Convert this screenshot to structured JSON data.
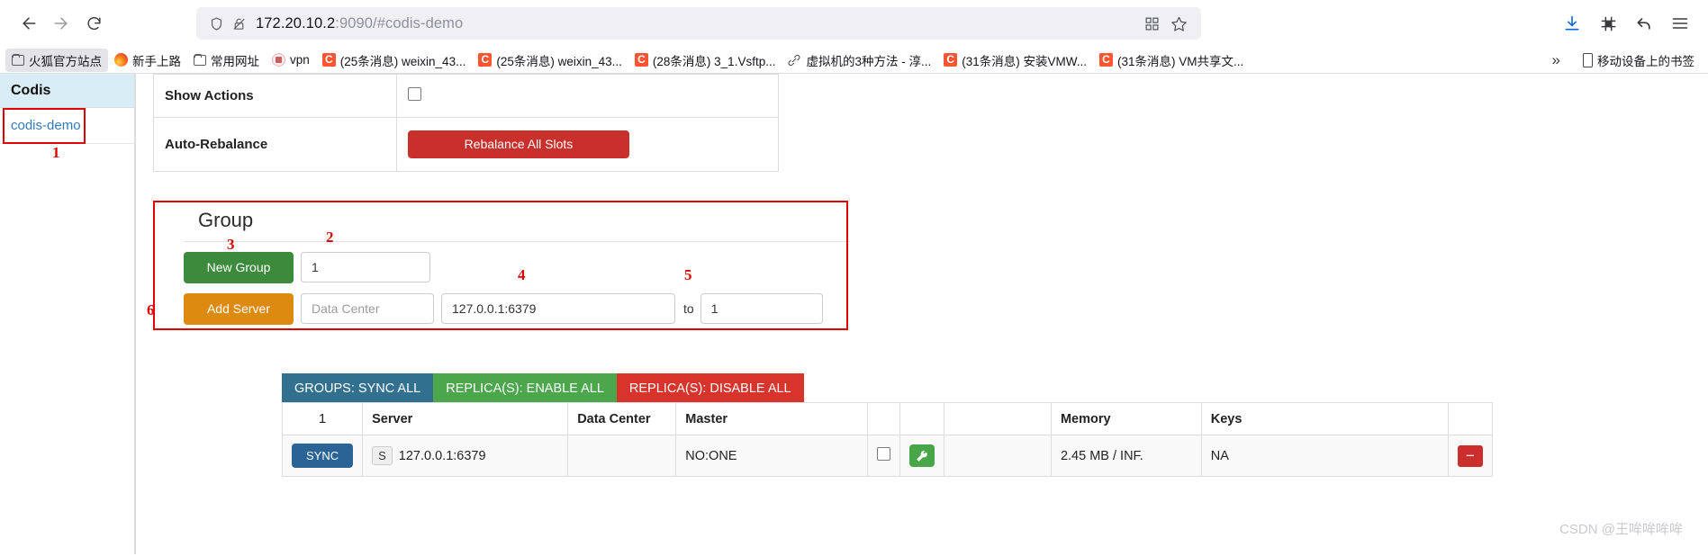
{
  "browser": {
    "nav": {
      "back_icon": "arrow-left-icon",
      "forward_icon": "arrow-right-icon",
      "reload_icon": "reload-icon"
    },
    "url_bar": {
      "shield_icon": "shield-icon",
      "lock_broken_icon": "lock-slash-icon",
      "url_host": "172.20.10.2",
      "url_rest": ":9090/#codis-demo",
      "qr_icon": "qr-code-icon",
      "bookmark_icon": "star-icon"
    },
    "toolbar_right": {
      "download_icon": "download-icon",
      "clip_icon": "clipboard-icon",
      "sync_icon": "undo-arrow-icon",
      "menu_icon": "hamburger-menu-icon"
    },
    "bookmarks": [
      {
        "label": "火狐官方站点",
        "icon": "folder-icon",
        "active": true
      },
      {
        "label": "新手上路",
        "icon": "firefox-icon",
        "active": false
      },
      {
        "label": "常用网址",
        "icon": "folder-icon",
        "active": false
      },
      {
        "label": "vpn",
        "icon": "vpn-site-icon",
        "active": false
      },
      {
        "label": "(25条消息) weixin_43...",
        "icon": "csdn-icon",
        "active": false
      },
      {
        "label": "(25条消息) weixin_43...",
        "icon": "csdn-icon",
        "active": false
      },
      {
        "label": "(28条消息) 3_1.Vsftp...",
        "icon": "csdn-icon",
        "active": false
      },
      {
        "label": "虚拟机的3种方法 - 淳...",
        "icon": "link-icon",
        "active": false
      },
      {
        "label": "(31条消息) 安装VMW...",
        "icon": "csdn-icon",
        "active": false
      },
      {
        "label": "(31条消息) VM共享文...",
        "icon": "csdn-icon",
        "active": false
      }
    ],
    "bookmarks_overflow_icon": "chevron-double-right-icon",
    "mobile_bookmarks": {
      "label": "移动设备上的书签",
      "icon": "phone-icon"
    }
  },
  "sidebar": {
    "title": "Codis",
    "items": [
      {
        "label": "codis-demo"
      }
    ]
  },
  "settings": {
    "rows": [
      {
        "label": "Show Actions",
        "control": "checkbox"
      },
      {
        "label": "Auto-Rebalance",
        "control": "button",
        "button_label": "Rebalance All Slots"
      }
    ]
  },
  "group_panel": {
    "heading": "Group",
    "new_group_button": "New Group",
    "new_group_value": "1",
    "add_server_button": "Add Server",
    "data_center_placeholder": "Data Center",
    "data_center_value": "",
    "address_value": "127.0.0.1:6379",
    "to_label": "to",
    "slot_value": "1"
  },
  "bulk_actions": [
    {
      "label": "GROUPS: SYNC ALL",
      "color": "#31708f"
    },
    {
      "label": "REPLICA(S): ENABLE ALL",
      "color": "#4ca64c"
    },
    {
      "label": "REPLICA(S): DISABLE ALL",
      "color": "#d9342b"
    }
  ],
  "servers_table": {
    "headers": {
      "index": "1",
      "server": "Server",
      "data_center": "Data Center",
      "master": "Master",
      "checkbox": "",
      "action": "",
      "blank": "",
      "memory": "Memory",
      "keys": "Keys",
      "delete": ""
    },
    "rows": [
      {
        "sync_label": "SYNC",
        "role_badge": "S",
        "server": "127.0.0.1:6379",
        "data_center": "",
        "master": "NO:ONE",
        "checkbox": false,
        "wrench_icon": "wrench-icon",
        "blank": "",
        "memory": "2.45 MB / INF.",
        "keys": "NA",
        "delete_icon": "minus-icon"
      }
    ]
  },
  "annotations": [
    {
      "id": "1",
      "target": "sidebar-item-codis-demo"
    },
    {
      "id": "2",
      "target": "new-group-input"
    },
    {
      "id": "3",
      "target": "new-group-button"
    },
    {
      "id": "4",
      "target": "address-input"
    },
    {
      "id": "5",
      "target": "slot-input"
    },
    {
      "id": "6",
      "target": "add-server-button"
    }
  ],
  "watermark": "CSDN @王哞哞哞哞",
  "colors": {
    "accent_blue": "#337ab7",
    "danger": "#c9302c",
    "success": "#3c8a3c",
    "warning": "#dd8b10",
    "sidebar_header_bg": "#d9edf7",
    "annotation": "#e10000"
  }
}
